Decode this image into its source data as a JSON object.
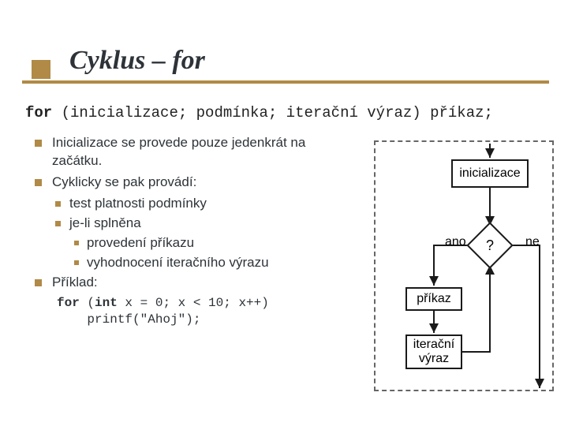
{
  "title": "Cyklus – for",
  "syntax": {
    "kw": "for",
    "rest": " (inicializace; podmínka; iterační výraz) příkaz;"
  },
  "bullets": {
    "b1a": "Inicializace se provede pouze jedenkrát na začátku.",
    "b1b": "Cyklicky se pak provádí:",
    "b2a": "test platnosti podmínky",
    "b2b": "je-li splněna",
    "b3a": "provedení příkazu",
    "b3b": "vyhodnocení iteračního výrazu",
    "b1c": "Příklad:"
  },
  "example": {
    "kw1": "for",
    "part1": " (",
    "kw2": "int",
    "part2": " x = 0; x < 10; x++)\n    printf(\"Ahoj\");"
  },
  "flow": {
    "init": "inicializace",
    "cond": "?",
    "yes": "ano",
    "no": "ne",
    "cmd": "příkaz",
    "iter": "iterační výraz"
  }
}
